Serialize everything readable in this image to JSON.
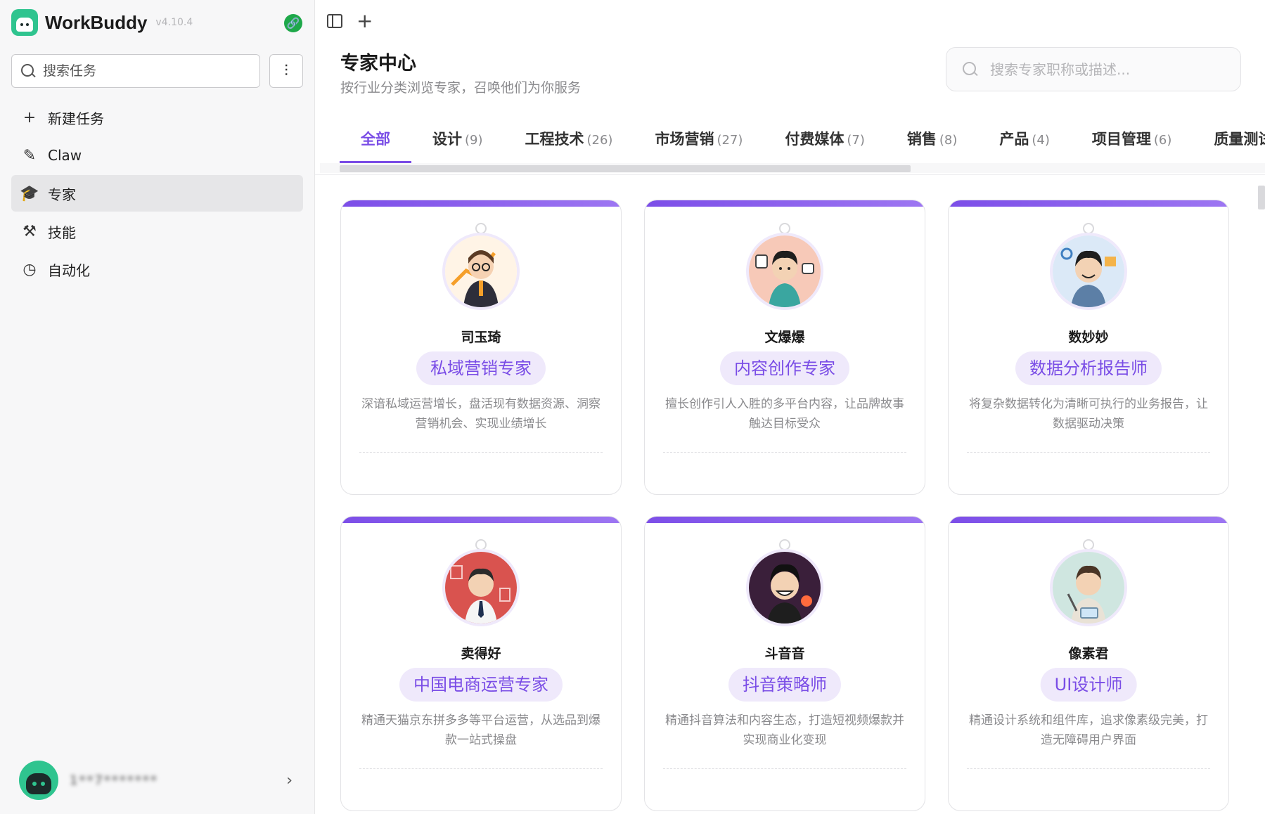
{
  "app": {
    "name": "WorkBuddy",
    "version": "v4.10.4"
  },
  "sidebar": {
    "search_placeholder": "搜索任务",
    "nav": [
      {
        "label": "新建任务",
        "icon": "plus-icon"
      },
      {
        "label": "Claw",
        "icon": "claw-icon"
      },
      {
        "label": "专家",
        "icon": "graduation-cap-icon",
        "active": true
      },
      {
        "label": "技能",
        "icon": "hammer-icon"
      },
      {
        "label": "自动化",
        "icon": "clock-icon"
      }
    ],
    "user": {
      "name": "1**7*******"
    }
  },
  "main": {
    "title": "专家中心",
    "subtitle": "按行业分类浏览专家，召唤他们为你服务",
    "search_placeholder": "搜索专家职称或描述...",
    "tabs": [
      {
        "label": "全部",
        "count": "",
        "active": true
      },
      {
        "label": "设计",
        "count": "(9)"
      },
      {
        "label": "工程技术",
        "count": "(26)"
      },
      {
        "label": "市场营销",
        "count": "(27)"
      },
      {
        "label": "付费媒体",
        "count": "(7)"
      },
      {
        "label": "销售",
        "count": "(8)"
      },
      {
        "label": "产品",
        "count": "(4)"
      },
      {
        "label": "项目管理",
        "count": "(6)"
      },
      {
        "label": "质量测试",
        "count": ""
      }
    ],
    "experts": [
      {
        "name": "司玉琦",
        "role": "私域营销专家",
        "desc": "深谙私域运营增长，盘活现有数据资源、洞察营销机会、实现业绩增长"
      },
      {
        "name": "文爆爆",
        "role": "内容创作专家",
        "desc": "擅长创作引人入胜的多平台内容，让品牌故事触达目标受众"
      },
      {
        "name": "数妙妙",
        "role": "数据分析报告师",
        "desc": "将复杂数据转化为清晰可执行的业务报告，让数据驱动决策"
      },
      {
        "name": "卖得好",
        "role": "中国电商运营专家",
        "desc": "精通天猫京东拼多多等平台运营，从选品到爆款一站式操盘"
      },
      {
        "name": "斗音音",
        "role": "抖音策略师",
        "desc": "精通抖音算法和内容生态，打造短视频爆款并实现商业化变现"
      },
      {
        "name": "像素君",
        "role": "UI设计师",
        "desc": "精通设计系统和组件库，追求像素级完美，打造无障碍用户界面"
      }
    ]
  }
}
